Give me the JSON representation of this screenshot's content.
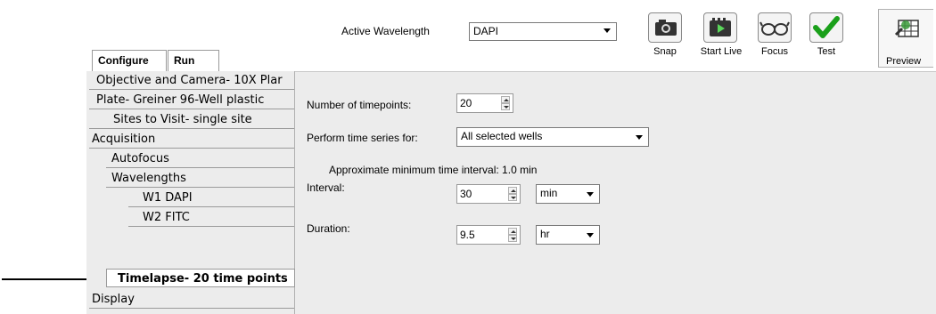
{
  "toolbar": {
    "active_wavelength_label": "Active Wavelength",
    "active_wavelength_value": "DAPI",
    "buttons": [
      {
        "label": "Snap",
        "icon": "camera-icon"
      },
      {
        "label": "Start Live",
        "icon": "video-camera-icon"
      },
      {
        "label": "Focus",
        "icon": "glasses-icon"
      },
      {
        "label": "Test",
        "icon": "checkmark-icon"
      },
      {
        "label": "Preview",
        "icon": "plate-preview-icon"
      }
    ]
  },
  "tabs": [
    {
      "label": "Configure",
      "active": true
    },
    {
      "label": "Run",
      "active": false
    }
  ],
  "tree": {
    "items": [
      {
        "label": "Objective and Camera- 10X Plar",
        "level": 0
      },
      {
        "label": "Plate- Greiner 96-Well plastic",
        "level": 0
      },
      {
        "label": "Sites to Visit- single site",
        "level": 1
      },
      {
        "label": "Acquisition",
        "level": 0
      },
      {
        "label": "Autofocus",
        "level": 1
      },
      {
        "label": "Wavelengths",
        "level": 1
      },
      {
        "label": "W1 DAPI",
        "level": 2
      },
      {
        "label": "W2 FITC",
        "level": 2
      },
      {
        "label": "Timelapse- 20 time points",
        "level": 1,
        "selected": true
      },
      {
        "label": "Display",
        "level": 0
      }
    ]
  },
  "timelapse": {
    "num_timepoints_label": "Number of timepoints:",
    "num_timepoints_value": "20",
    "perform_for_label": "Perform time series for:",
    "perform_for_value": "All selected wells",
    "approx_text": "Approximate minimum time interval: 1.0 min",
    "interval_label": "Interval:",
    "interval_value": "30",
    "interval_unit": "min",
    "duration_label": "Duration:",
    "duration_value": "9.5",
    "duration_unit": "hr"
  },
  "colors": {
    "panel_bg": "#ececec",
    "check_green": "#1aa01a"
  }
}
